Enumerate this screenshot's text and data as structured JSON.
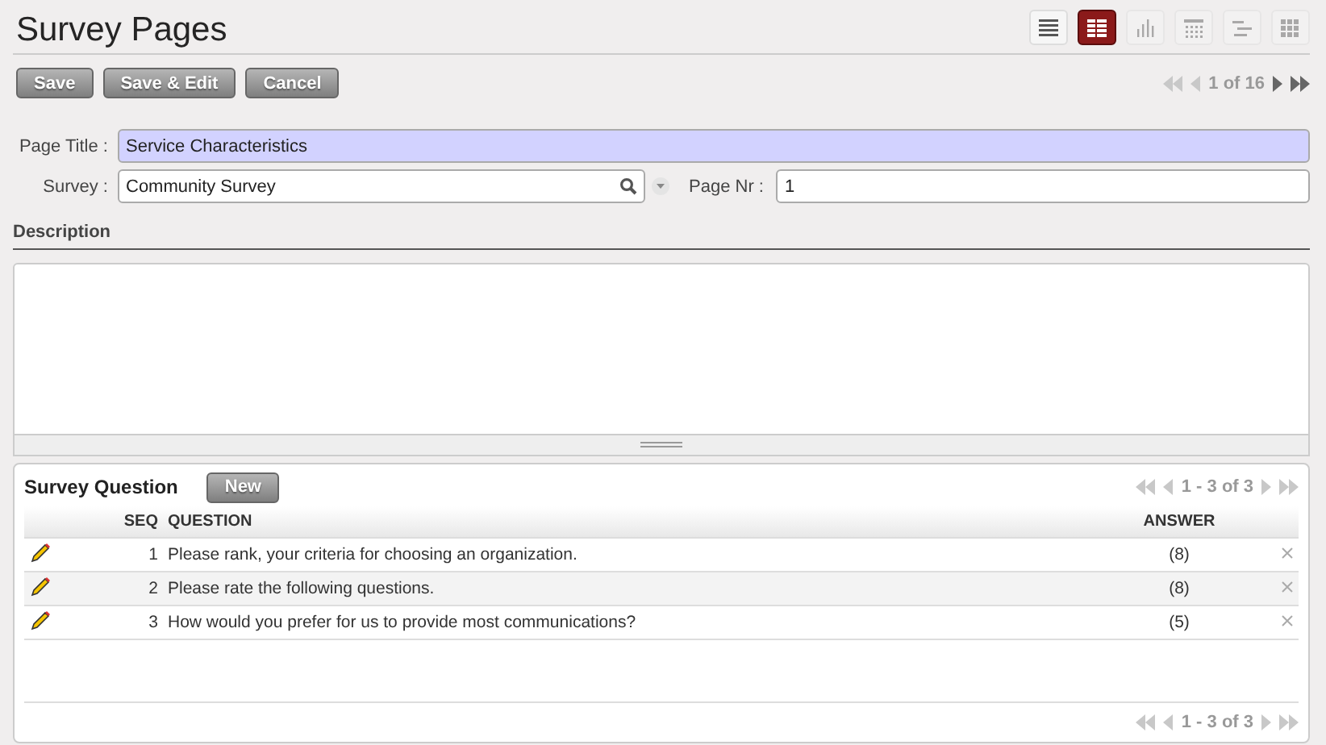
{
  "title": "Survey Pages",
  "views": [
    {
      "kind": "list",
      "selected": false,
      "disabled": false
    },
    {
      "kind": "form",
      "selected": true,
      "disabled": false
    },
    {
      "kind": "graph",
      "selected": false,
      "disabled": true
    },
    {
      "kind": "calendar",
      "selected": false,
      "disabled": true
    },
    {
      "kind": "gantt",
      "selected": false,
      "disabled": true
    },
    {
      "kind": "kanban",
      "selected": false,
      "disabled": true
    }
  ],
  "buttons": [
    "Save",
    "Save & Edit",
    "Cancel"
  ],
  "pager": {
    "text": "1 of 16",
    "back_disabled": true,
    "forward_disabled": false
  },
  "fields": {
    "page_title": {
      "label": "Page Title :",
      "value": "Service Characteristics"
    },
    "survey": {
      "label": "Survey :",
      "value": "Community Survey"
    },
    "page_nr": {
      "label": "Page Nr :",
      "value": "1"
    }
  },
  "description": {
    "label": "Description"
  },
  "questions": {
    "title": "Survey Question",
    "new_button": "New",
    "pager_top": "1 - 3 of 3",
    "pager_bottom": "1 - 3 of 3",
    "columns": [
      "SEQ",
      "QUESTION",
      "ANSWER"
    ],
    "rows": [
      {
        "seq": "1",
        "question": "Please rank, your criteria for choosing an organization.",
        "answer": "(8)"
      },
      {
        "seq": "2",
        "question": "Please rate the following questions.",
        "answer": "(8)"
      },
      {
        "seq": "3",
        "question": "How would you prefer for us to provide most communications?",
        "answer": "(5)"
      }
    ]
  }
}
